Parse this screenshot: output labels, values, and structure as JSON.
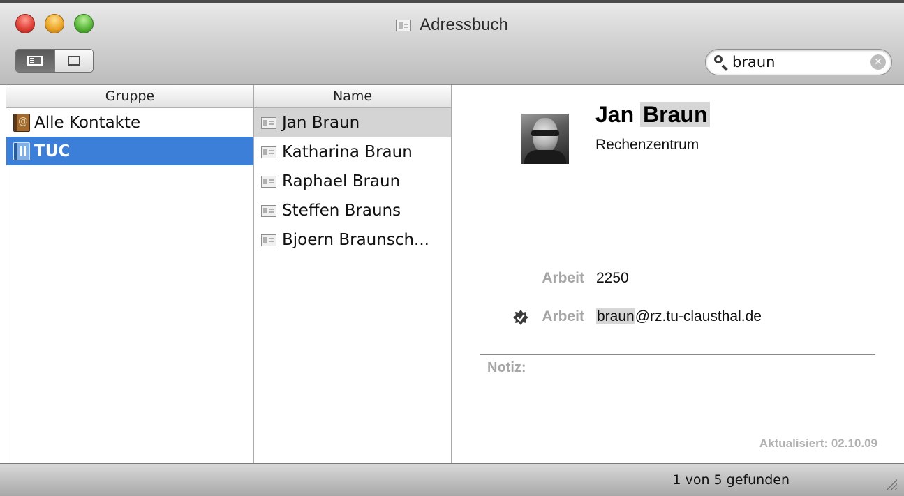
{
  "window": {
    "title": "Adressbuch"
  },
  "search": {
    "value": "braun"
  },
  "groups": {
    "header": "Gruppe",
    "items": [
      {
        "label": "Alle Kontakte"
      },
      {
        "label": "TUC"
      }
    ]
  },
  "names": {
    "header": "Name",
    "items": [
      {
        "label": "Jan Braun"
      },
      {
        "label": "Katharina Braun"
      },
      {
        "label": "Raphael Braun"
      },
      {
        "label": "Steffen Brauns"
      },
      {
        "label": "Bjoern Braunsch..."
      }
    ]
  },
  "contact": {
    "first_name": "Jan",
    "last_name": "Braun",
    "organization": "Rechenzentrum",
    "phone": {
      "label": "Arbeit",
      "value": "2250"
    },
    "email": {
      "label": "Arbeit",
      "value_highlight": "braun",
      "value_rest": "@rz.tu-clausthal.de"
    },
    "note_label": "Notiz:",
    "updated": "Aktualisiert: 02.10.09"
  },
  "status": {
    "text": "1 von 5 gefunden"
  },
  "colors": {
    "selection_blue": "#3c7fd9",
    "selection_gray": "#d4d4d4",
    "label_gray": "#a6a6a6"
  },
  "icons": {
    "window_controls": [
      "close-icon",
      "minimize-icon",
      "zoom-icon"
    ],
    "view_modes": [
      "card-and-columns-icon",
      "card-only-icon"
    ],
    "search": "search-icon",
    "clear": "clear-search-icon",
    "group_all": "address-book-icon",
    "group_tuc": "directory-book-icon",
    "contact": "contact-card-icon",
    "email_badge": "verified-badge-icon"
  }
}
